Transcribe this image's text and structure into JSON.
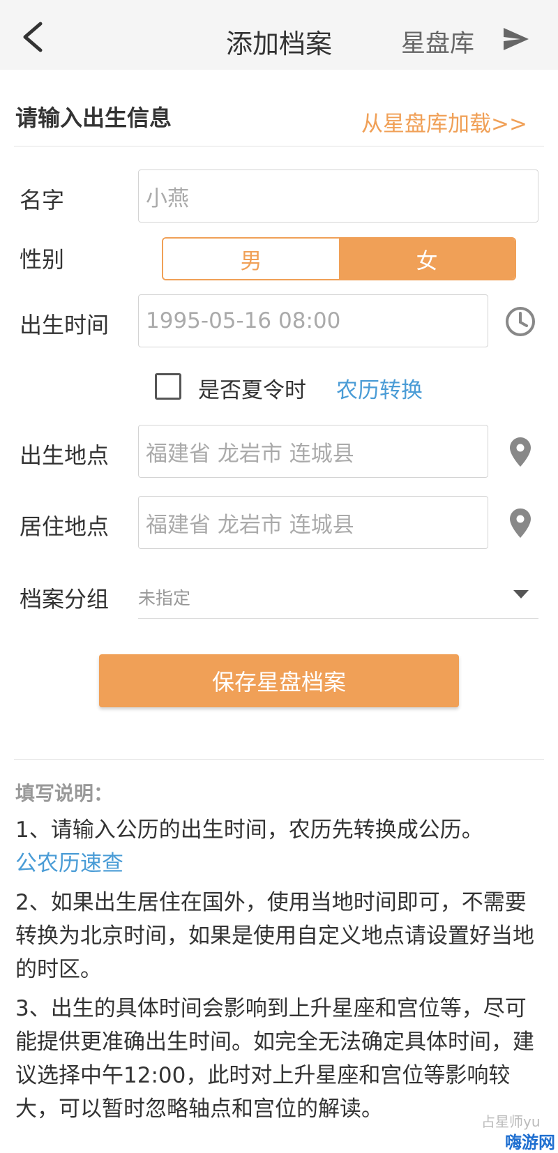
{
  "navbar": {
    "title": "添加档案",
    "library": "星盘库",
    "back_icon": "chevron-left-icon",
    "send_icon": "send-icon"
  },
  "section": {
    "title": "请输入出生信息",
    "load_link": "从星盘库加载>>"
  },
  "form": {
    "name_label": "名字",
    "name_placeholder": "小燕",
    "gender_label": "性别",
    "gender_male": "男",
    "gender_female": "女",
    "gender_selected": "女",
    "birth_time_label": "出生时间",
    "birth_time_value": "1995-05-16 08:00",
    "clock_icon": "clock-icon",
    "dst_label": "是否夏令时",
    "dst_checked": false,
    "lunar_link": "农历转换",
    "birth_place_label": "出生地点",
    "birth_place_value": "福建省 龙岩市 连城县",
    "residence_label": "居住地点",
    "residence_value": "福建省 龙岩市 连城县",
    "location_icon": "map-pin-icon",
    "group_label": "档案分组",
    "group_value": "未指定"
  },
  "save_button": "保存星盘档案",
  "notes": {
    "title": "填写说明：",
    "item1": "1、请输入公历的出生时间，农历先转换成公历。",
    "item1_link": "公农历速查",
    "item2": "2、如果出生居住在国外，使用当地时间即可，不需要转换为北京时间，如果是使用自定义地点请设置好当地的时区。",
    "item3": "3、出生的具体时间会影响到上升星座和宫位等，尽可能提供更准确出生时间。如完全无法确定具体时间，建议选择中午12:00，此时对上升星座和宫位等影响较大，可以暂时忽略轴点和宫位的解读。"
  },
  "watermark": {
    "author": "占星师yu",
    "brand": "嗨游网"
  },
  "colors": {
    "accent": "#f0a057",
    "link": "#4a9cd6",
    "navbar_bg": "#f5f5f5"
  }
}
